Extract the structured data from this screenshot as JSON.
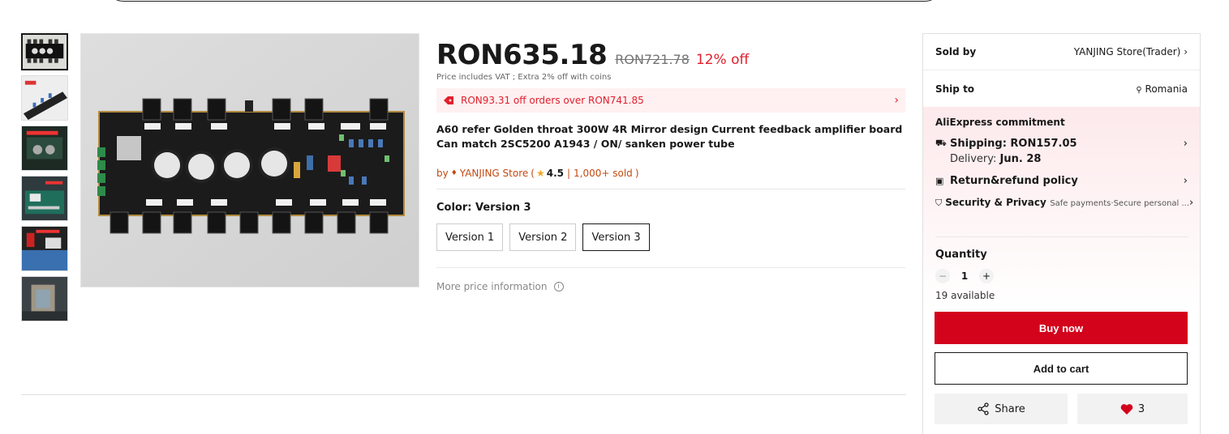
{
  "product": {
    "price": "RON635.18",
    "original_price": "RON721.78",
    "discount": "12% off",
    "vat_note": "Price includes VAT ; Extra 2% off with coins",
    "promo": "RON93.31 off orders over RON741.85",
    "title": "A60 refer Golden throat 300W 4R Mirror design Current feedback amplifier board Can match 2SC5200 A1943 / ON/ sanken power tube",
    "seller_prefix": "by",
    "store_name": "YANJING Store",
    "rating": "4.5",
    "sold": "1,000+ sold",
    "color_label": "Color: Version 3",
    "variants": [
      "Version 1",
      "Version 2",
      "Version 3"
    ],
    "more_price": "More price information"
  },
  "panel": {
    "sold_by_label": "Sold by",
    "sold_by_value": "YANJING Store(Trader)",
    "ship_to_label": "Ship to",
    "ship_to_value": "Romania",
    "commitment_title": "AliExpress commitment",
    "shipping": "Shipping: RON157.05",
    "delivery_label": "Delivery:",
    "delivery_date": "Jun. 28",
    "return_policy": "Return&refund policy",
    "security": "Security & Privacy",
    "security_sub": "Safe payments·Secure personal ...",
    "quantity_label": "Quantity",
    "quantity": "1",
    "available": "19 available",
    "buy_now": "Buy now",
    "add_to_cart": "Add to cart",
    "share": "Share",
    "wish_count": "3"
  },
  "colors": {
    "accent": "#d3031c",
    "promo_bg": "#fff0f1",
    "store_link": "#c34a12"
  }
}
